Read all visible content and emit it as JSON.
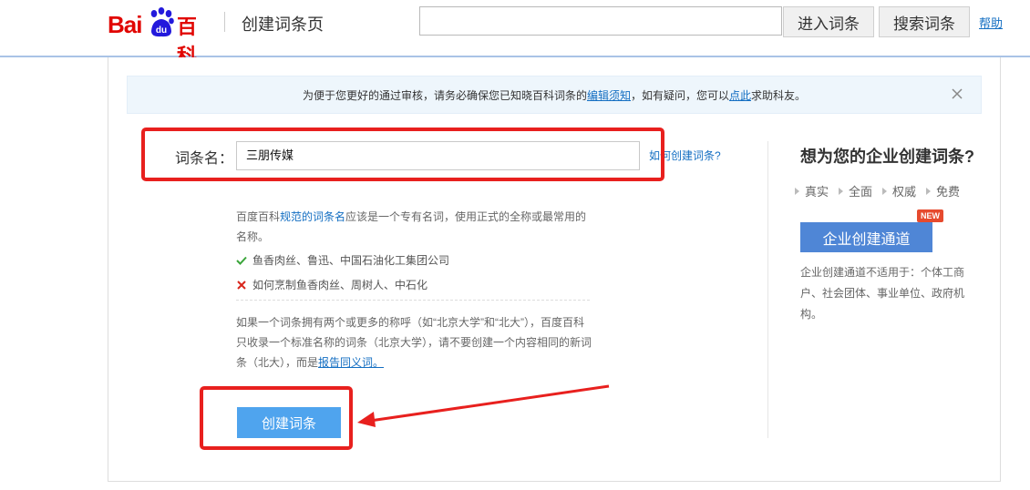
{
  "header": {
    "logo_bai": "Bai",
    "logo_du": "du",
    "logo_baike": "百科",
    "page_title": "创建词条页",
    "search_value": "",
    "enter_button": "进入词条",
    "search_button": "搜索词条",
    "help_link": "帮助"
  },
  "notice": {
    "text_before": "为便于您更好的通过审核，请务必确保您已知晓百科词条的",
    "link1": "编辑须知",
    "text_mid": "，如有疑问，您可以",
    "link2": "点此",
    "text_after": "求助科友。"
  },
  "form": {
    "name_label": "词条名：",
    "name_value": "三朋传媒",
    "how_link": "如何创建词条?",
    "tip1_before": "百度百科",
    "tip1_link": "规范的词条名",
    "tip1_after": "应该是一个专有名词，使用正式的全称或最常用的名称。",
    "good_example": "鱼香肉丝、鲁迅、中国石油化工集团公司",
    "bad_example": "如何烹制鱼香肉丝、周树人、中石化",
    "tip2_text": "如果一个词条拥有两个或更多的称呼（如“北京大学”和“北大”），百度百科只收录一个标准名称的词条（北京大学），请不要创建一个内容相同的新词条（北大），而是",
    "tip2_link": "报告同义词。",
    "create_button": "创建词条"
  },
  "sidebar": {
    "title": "想为您的企业创建词条?",
    "features": [
      "真实",
      "全面",
      "权威",
      "免费"
    ],
    "enterprise_button": "企业创建通道",
    "new_badge": "NEW",
    "description": "企业创建通道不适用于：个体工商户、社会团体、事业单位、政府机构。"
  },
  "colors": {
    "brand_red": "#e10602",
    "brand_blue": "#2319dc",
    "link_blue": "#136ec2",
    "annotation_red": "#e8201e"
  }
}
